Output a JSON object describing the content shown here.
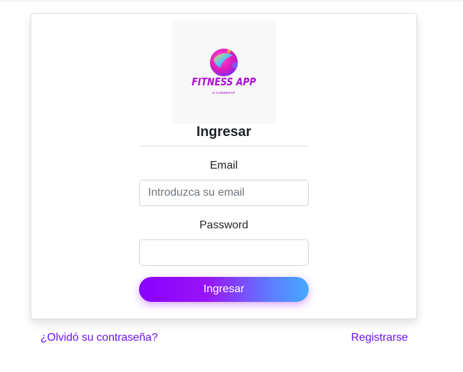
{
  "logo": {
    "title": "FITNESS APP",
    "subtitle": "E-COMMERCE",
    "brand_color": "#b10fd4"
  },
  "form": {
    "title": "Ingresar",
    "email_label": "Email",
    "email_placeholder": "Introduzca su email",
    "email_value": "",
    "password_label": "Password",
    "password_value": "",
    "submit_label": "Ingresar"
  },
  "links": {
    "forgot_password": "¿Olvidó su contraseña?",
    "register": "Registrarse"
  },
  "colors": {
    "link": "#6a12f0",
    "button_gradient_start": "#8a00ff",
    "button_gradient_end": "#44a8ff"
  }
}
